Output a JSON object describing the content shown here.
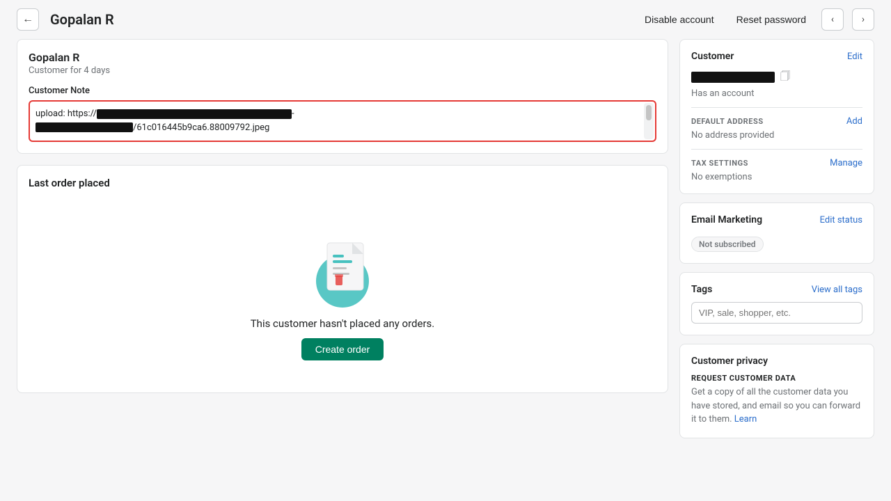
{
  "topbar": {
    "back_icon": "←",
    "title": "Gopalan R",
    "disable_account_label": "Disable account",
    "reset_password_label": "Reset password",
    "prev_icon": "‹",
    "next_icon": "›"
  },
  "customer_card": {
    "name": "Gopalan R",
    "tenure": "Customer for 4 days",
    "note_label": "Customer Note",
    "note_line1": "upload: https://",
    "note_line2": "/61c016445b9ca6.88009792.jpeg"
  },
  "last_order": {
    "title": "Last order placed",
    "empty_text": "This customer hasn't placed any orders.",
    "create_order_label": "Create order"
  },
  "customer_panel": {
    "title": "Customer",
    "edit_label": "Edit",
    "has_account": "Has an account",
    "default_address": {
      "title": "DEFAULT ADDRESS",
      "add_label": "Add",
      "value": "No address provided"
    },
    "tax_settings": {
      "title": "TAX SETTINGS",
      "manage_label": "Manage",
      "value": "No exemptions"
    }
  },
  "email_marketing": {
    "title": "Email Marketing",
    "edit_status_label": "Edit status",
    "badge": "Not subscribed"
  },
  "tags": {
    "title": "Tags",
    "view_all_label": "View all tags",
    "input_placeholder": "VIP, sale, shopper, etc."
  },
  "customer_privacy": {
    "title": "Customer privacy",
    "request_title": "REQUEST CUSTOMER DATA",
    "request_desc": "Get a copy of all the customer data you have stored, and email so you can forward it to them.",
    "request_link_text": "Learn"
  }
}
